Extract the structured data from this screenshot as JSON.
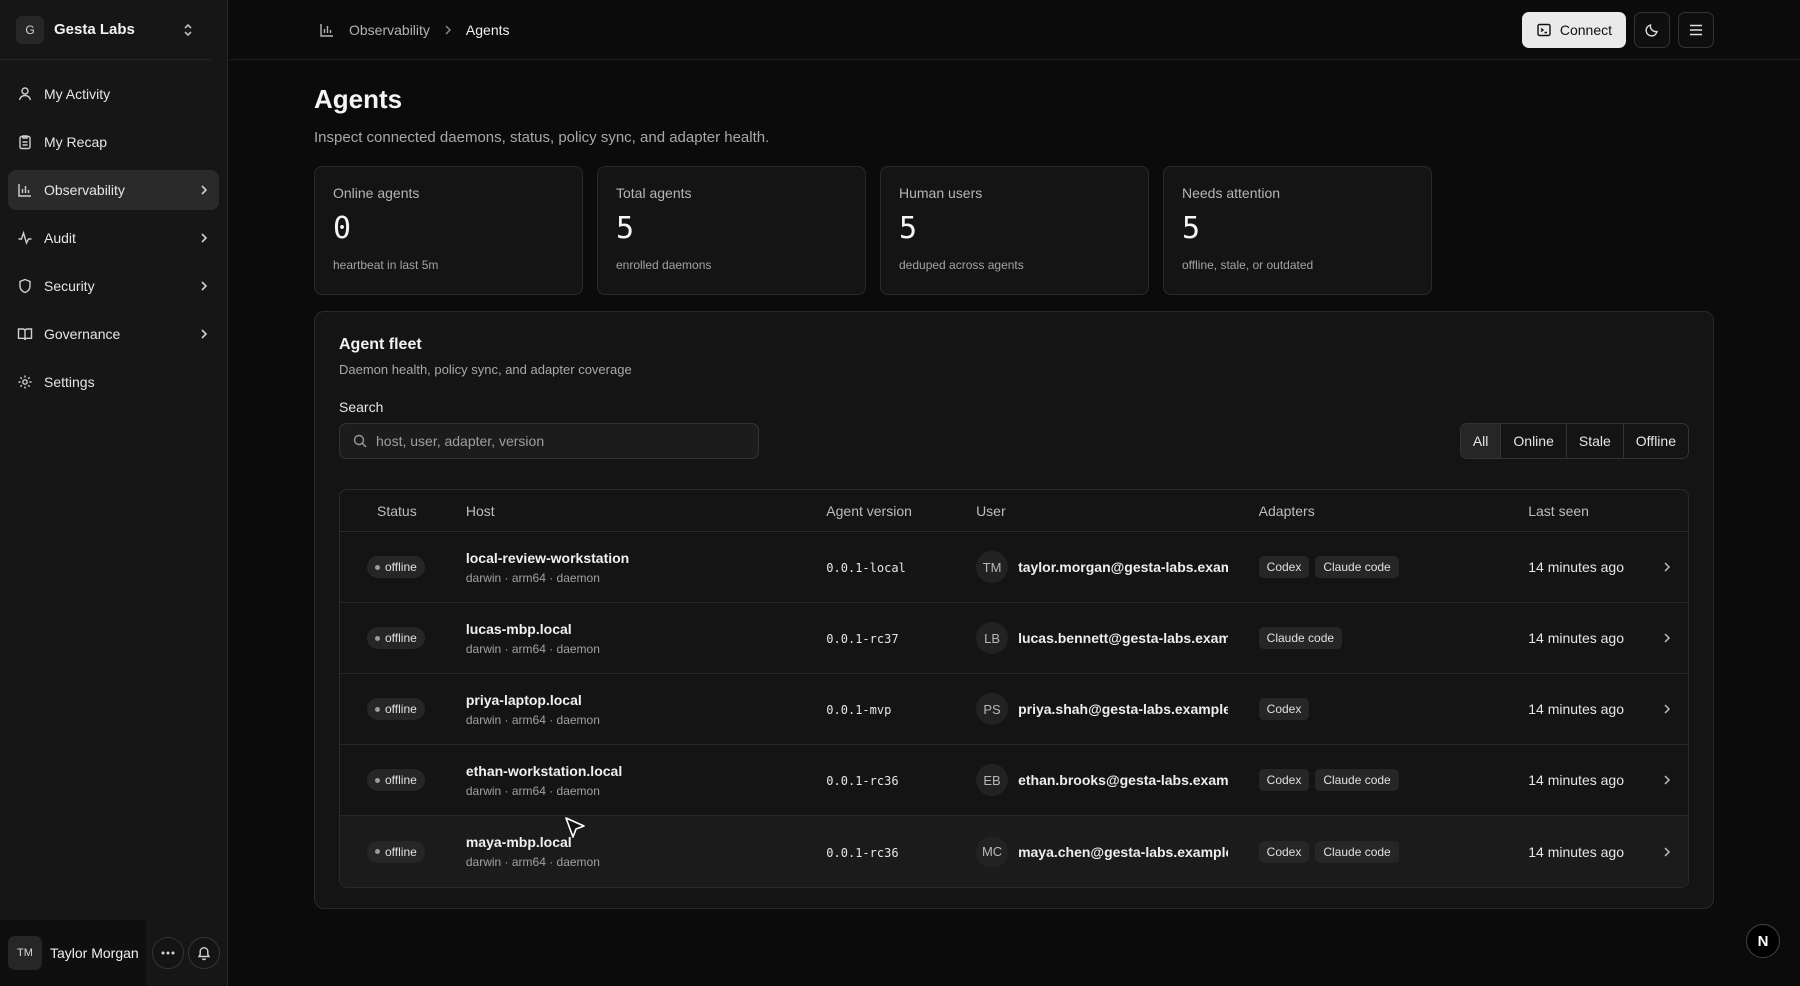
{
  "brand": {
    "logo_letter": "G",
    "name": "Gesta Labs"
  },
  "sidebar": {
    "items": [
      {
        "label": "My Activity",
        "icon": "user-icon"
      },
      {
        "label": "My Recap",
        "icon": "clipboard-icon"
      },
      {
        "label": "Observability",
        "icon": "bar-chart-icon",
        "active": true
      },
      {
        "label": "Audit",
        "icon": "activity-icon"
      },
      {
        "label": "Security",
        "icon": "shield-icon"
      },
      {
        "label": "Governance",
        "icon": "book-icon"
      },
      {
        "label": "Settings",
        "icon": "gear-icon"
      }
    ]
  },
  "user": {
    "initials": "TM",
    "name": "Taylor Morgan"
  },
  "breadcrumb": {
    "parent": "Observability",
    "current": "Agents"
  },
  "topbar": {
    "connect_label": "Connect"
  },
  "page": {
    "title": "Agents",
    "subtitle": "Inspect connected daemons, status, policy sync, and adapter health."
  },
  "stats": [
    {
      "label": "Online agents",
      "value": "0",
      "note": "heartbeat in last 5m"
    },
    {
      "label": "Total agents",
      "value": "5",
      "note": "enrolled daemons"
    },
    {
      "label": "Human users",
      "value": "5",
      "note": "deduped across agents"
    },
    {
      "label": "Needs attention",
      "value": "5",
      "note": "offline, stale, or outdated"
    }
  ],
  "fleet": {
    "title": "Agent fleet",
    "subtitle": "Daemon health, policy sync, and adapter coverage",
    "search_label": "Search",
    "search_placeholder": "host, user, adapter, version",
    "filters": [
      "All",
      "Online",
      "Stale",
      "Offline"
    ],
    "active_filter": "All",
    "columns": [
      "Status",
      "Host",
      "Agent version",
      "User",
      "Adapters",
      "Last seen"
    ],
    "rows": [
      {
        "status": "offline",
        "host": "local-review-workstation",
        "meta": "darwin · arm64 · daemon",
        "version": "0.0.1-local",
        "initials": "TM",
        "email": "taylor.morgan@gesta-labs.example",
        "adapters": [
          "Codex",
          "Claude code"
        ],
        "last_seen": "14 minutes ago"
      },
      {
        "status": "offline",
        "host": "lucas-mbp.local",
        "meta": "darwin · arm64 · daemon",
        "version": "0.0.1-rc37",
        "initials": "LB",
        "email": "lucas.bennett@gesta-labs.example",
        "adapters": [
          "Claude code"
        ],
        "last_seen": "14 minutes ago"
      },
      {
        "status": "offline",
        "host": "priya-laptop.local",
        "meta": "darwin · arm64 · daemon",
        "version": "0.0.1-mvp",
        "initials": "PS",
        "email": "priya.shah@gesta-labs.example",
        "adapters": [
          "Codex"
        ],
        "last_seen": "14 minutes ago"
      },
      {
        "status": "offline",
        "host": "ethan-workstation.local",
        "meta": "darwin · arm64 · daemon",
        "version": "0.0.1-rc36",
        "initials": "EB",
        "email": "ethan.brooks@gesta-labs.example",
        "adapters": [
          "Codex",
          "Claude code"
        ],
        "last_seen": "14 minutes ago"
      },
      {
        "status": "offline",
        "host": "maya-mbp.local",
        "meta": "darwin · arm64 · daemon",
        "version": "0.0.1-rc36",
        "initials": "MC",
        "email": "maya.chen@gesta-labs.example",
        "adapters": [
          "Codex",
          "Claude code"
        ],
        "last_seen": "14 minutes ago"
      }
    ]
  },
  "corner_badge": "N"
}
